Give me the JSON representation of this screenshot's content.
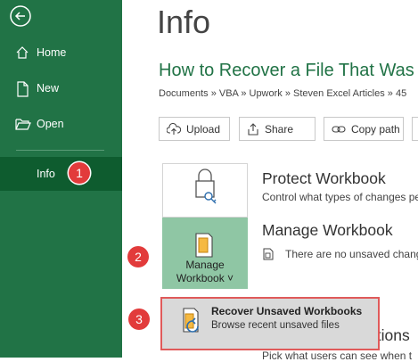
{
  "sidebar": {
    "items": [
      {
        "label": "Home",
        "icon": "home-icon"
      },
      {
        "label": "New",
        "icon": "new-document-icon"
      },
      {
        "label": "Open",
        "icon": "folder-open-icon"
      },
      {
        "label": "Info",
        "selected": true
      }
    ]
  },
  "main": {
    "page_title": "Info",
    "doc_title": "How to Recover a File That Was",
    "breadcrumb": "Documents » VBA » Upwork » Steven Excel Articles » 45",
    "actions": [
      {
        "label": "Upload",
        "icon": "upload-icon"
      },
      {
        "label": "Share",
        "icon": "share-icon"
      },
      {
        "label": "Copy path",
        "icon": "link-icon"
      }
    ],
    "protect": {
      "title": "Protect Workbook",
      "description": "Control what types of changes pe"
    },
    "manage": {
      "button_line1": "Manage",
      "button_line2": "Workbook ˅",
      "title": "Manage Workbook",
      "description": "There are no unsaved change"
    },
    "dropdown": {
      "title": "Recover Unsaved Workbooks",
      "description": "Browse recent unsaved files"
    },
    "partial_section_title": "ptions",
    "partial_section_desc": "Pick what users can see when t"
  },
  "annotations": [
    "1",
    "2",
    "3"
  ],
  "colors": {
    "brand_green": "#217346",
    "selected_green": "#0e5c2f",
    "badge_red": "#e23b3b",
    "tile_green": "#8fc6a4"
  }
}
